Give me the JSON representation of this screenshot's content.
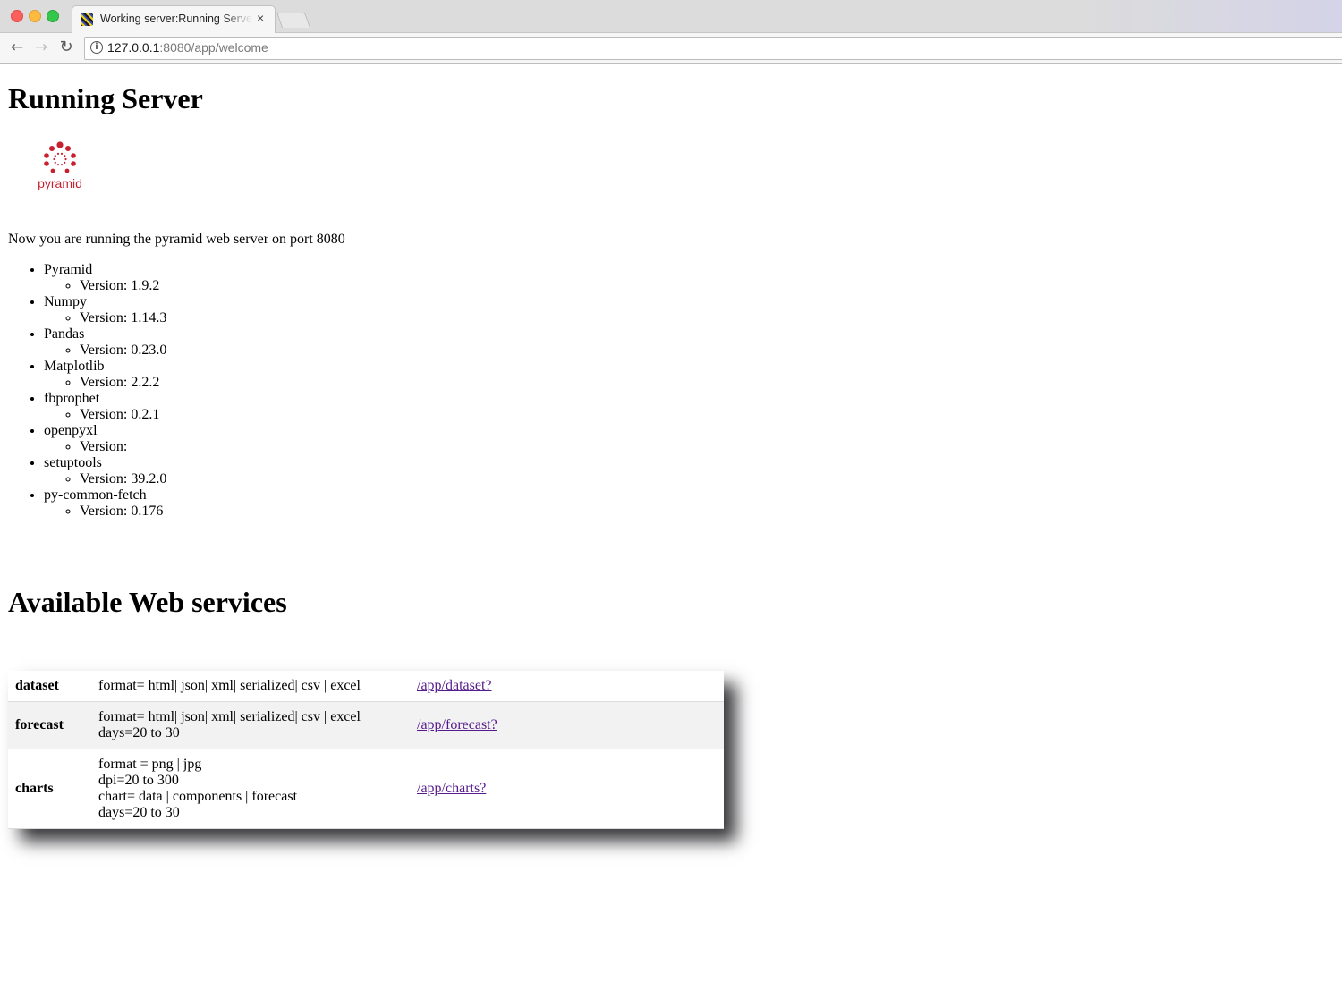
{
  "browser": {
    "tab_title": "Working server:Running Server",
    "tab_close": "×",
    "url_host": "127.0.0.1",
    "url_rest": ":8080/app/welcome",
    "icons": {
      "back": "arrow-left",
      "forward": "arrow-right",
      "reload": "reload",
      "info": "info-circle"
    }
  },
  "page": {
    "title": "Running Server",
    "logo_text": "pyramid",
    "intro": "Now you are running the pyramid web server on port 8080",
    "packages": [
      {
        "name": "Pyramid",
        "version": "Version: 1.9.2"
      },
      {
        "name": "Numpy",
        "version": "Version: 1.14.3"
      },
      {
        "name": "Pandas",
        "version": "Version: 0.23.0"
      },
      {
        "name": "Matplotlib",
        "version": "Version: 2.2.2"
      },
      {
        "name": "fbprophet",
        "version": "Version: 0.2.1"
      },
      {
        "name": "openpyxl",
        "version": "Version: "
      },
      {
        "name": "setuptools",
        "version": "Version: 39.2.0"
      },
      {
        "name": "py-common-fetch",
        "version": "Version: 0.176"
      }
    ],
    "services_title": "Available Web services",
    "services": [
      {
        "name": "dataset",
        "params": [
          "format= html| json| xml| serialized| csv | excel"
        ],
        "link": "/app/dataset?"
      },
      {
        "name": "forecast",
        "params": [
          "format= html| json| xml| serialized| csv | excel",
          "days=20 to 30"
        ],
        "link": "/app/forecast?"
      },
      {
        "name": "charts",
        "params": [
          "format = png | jpg",
          "dpi=20 to 300",
          "chart= data | components | forecast",
          "days=20 to 30"
        ],
        "link": "/app/charts?"
      }
    ]
  },
  "colors": {
    "link_visited": "#551a8b",
    "logo_red": "#c8202f"
  }
}
